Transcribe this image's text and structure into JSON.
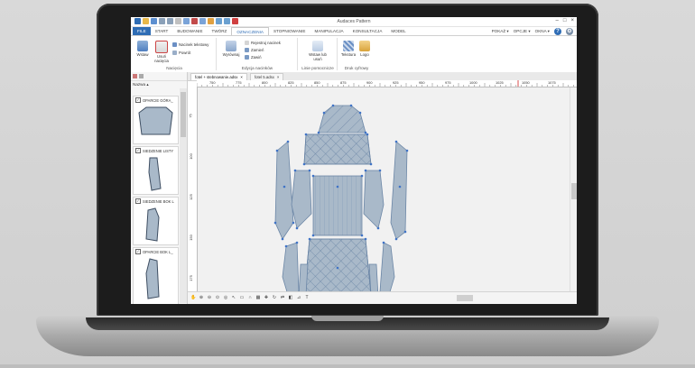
{
  "app": {
    "title": "Audaces Pattern",
    "window_controls": [
      "–",
      "□",
      "×"
    ]
  },
  "ribbon": {
    "tabs": [
      {
        "label": "FILE",
        "style": "file"
      },
      {
        "label": "START",
        "style": ""
      },
      {
        "label": "BUDOWANIE",
        "style": ""
      },
      {
        "label": "TWÓRZ",
        "style": ""
      },
      {
        "label": "OZNACZENIA",
        "style": "active"
      },
      {
        "label": "STOPNIOWANIE",
        "style": ""
      },
      {
        "label": "MANIPULACJA",
        "style": ""
      },
      {
        "label": "KONSULTACJA",
        "style": ""
      },
      {
        "label": "MODEL",
        "style": ""
      }
    ],
    "right": {
      "pokaz": "POKAŻ ▾",
      "opcje": "OPCJE ▾",
      "okna": "OKNA ▾",
      "help": "?"
    },
    "groups": {
      "naciecia": {
        "label": "Nacięcia",
        "wstaw": "Wstaw",
        "usun": "Usuń nacięcia",
        "tekstowy": "Nacinek tekstowy",
        "powrot": "Powrót"
      },
      "edycja": {
        "label": "Edycja nacinków",
        "wyrownaj": "Wyrównaj",
        "rejestruj": "Rejestruj nacinek",
        "zamien": "Zamień",
        "zawin": "Zawiń"
      },
      "linie": {
        "label": "Linie pomocnicze",
        "wstaw_usun": "Wstaw lub usuń"
      },
      "druk": {
        "label": "Druk cyfrowy",
        "tekstura": "Tekstura",
        "logo": "Logo"
      }
    },
    "colors": {
      "file_tab": "#2f6db5",
      "accent": "#2f6db5"
    }
  },
  "left_panel": {
    "header": "Nazwa",
    "pieces": [
      {
        "label": "OPARCIE GÓRA_",
        "checked": true
      },
      {
        "label": "SIEDZENIE LISTY",
        "checked": true
      },
      {
        "label": "SIEDZENIE BOK L",
        "checked": true
      },
      {
        "label": "OPARCIE BOK L_",
        "checked": true
      }
    ]
  },
  "documents": {
    "tabs": [
      {
        "label": "fotel + stebnowanie.adsx",
        "active": true
      },
      {
        "label": "fotel 5.adsx",
        "active": false
      }
    ]
  },
  "rulers": {
    "top": [
      "750",
      "775",
      "800",
      "825",
      "850",
      "875",
      "900",
      "925",
      "950",
      "975",
      "1000",
      "1025",
      "1050",
      "1075"
    ],
    "left": [
      "75",
      "100",
      "125",
      "150",
      "175"
    ]
  },
  "canvas": {
    "piece_fill": "#a9b9c9",
    "piece_stroke": "#6b86a6",
    "point_color": "#3f73c6"
  }
}
